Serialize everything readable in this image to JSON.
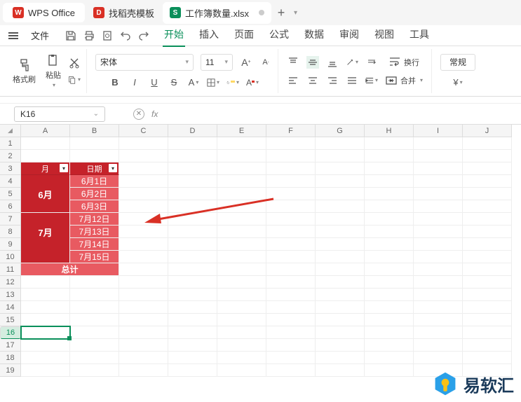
{
  "titlebar": {
    "app_name": "WPS Office",
    "template_tab": "找稻壳模板",
    "file_tab": "工作簿数量.xlsx"
  },
  "menubar": {
    "file": "文件",
    "tabs": [
      "开始",
      "插入",
      "页面",
      "公式",
      "数据",
      "审阅",
      "视图",
      "工具"
    ],
    "active_index": 0
  },
  "ribbon": {
    "format_painter": "格式刷",
    "paste": "粘贴",
    "font_name": "宋体",
    "font_size": "11",
    "wrap": "换行",
    "merge": "合并",
    "general": "常规",
    "currency": "¥"
  },
  "formula_bar": {
    "cell_ref": "K16",
    "fx_label": "fx"
  },
  "grid": {
    "columns": [
      "A",
      "B",
      "C",
      "D",
      "E",
      "F",
      "G",
      "H",
      "I",
      "J"
    ],
    "rows": [
      "1",
      "2",
      "3",
      "4",
      "5",
      "6",
      "7",
      "8",
      "9",
      "10",
      "11",
      "12",
      "13",
      "14",
      "15",
      "16",
      "17",
      "18",
      "19"
    ],
    "active_row": 16,
    "header_month": "月",
    "header_date": "日期",
    "month1": "6月",
    "month2": "7月",
    "dates": [
      "6月1日",
      "6月2日",
      "6月3日",
      "7月12日",
      "7月13日",
      "7月14日",
      "7月15日"
    ],
    "total": "总计"
  },
  "watermark": "易软汇"
}
